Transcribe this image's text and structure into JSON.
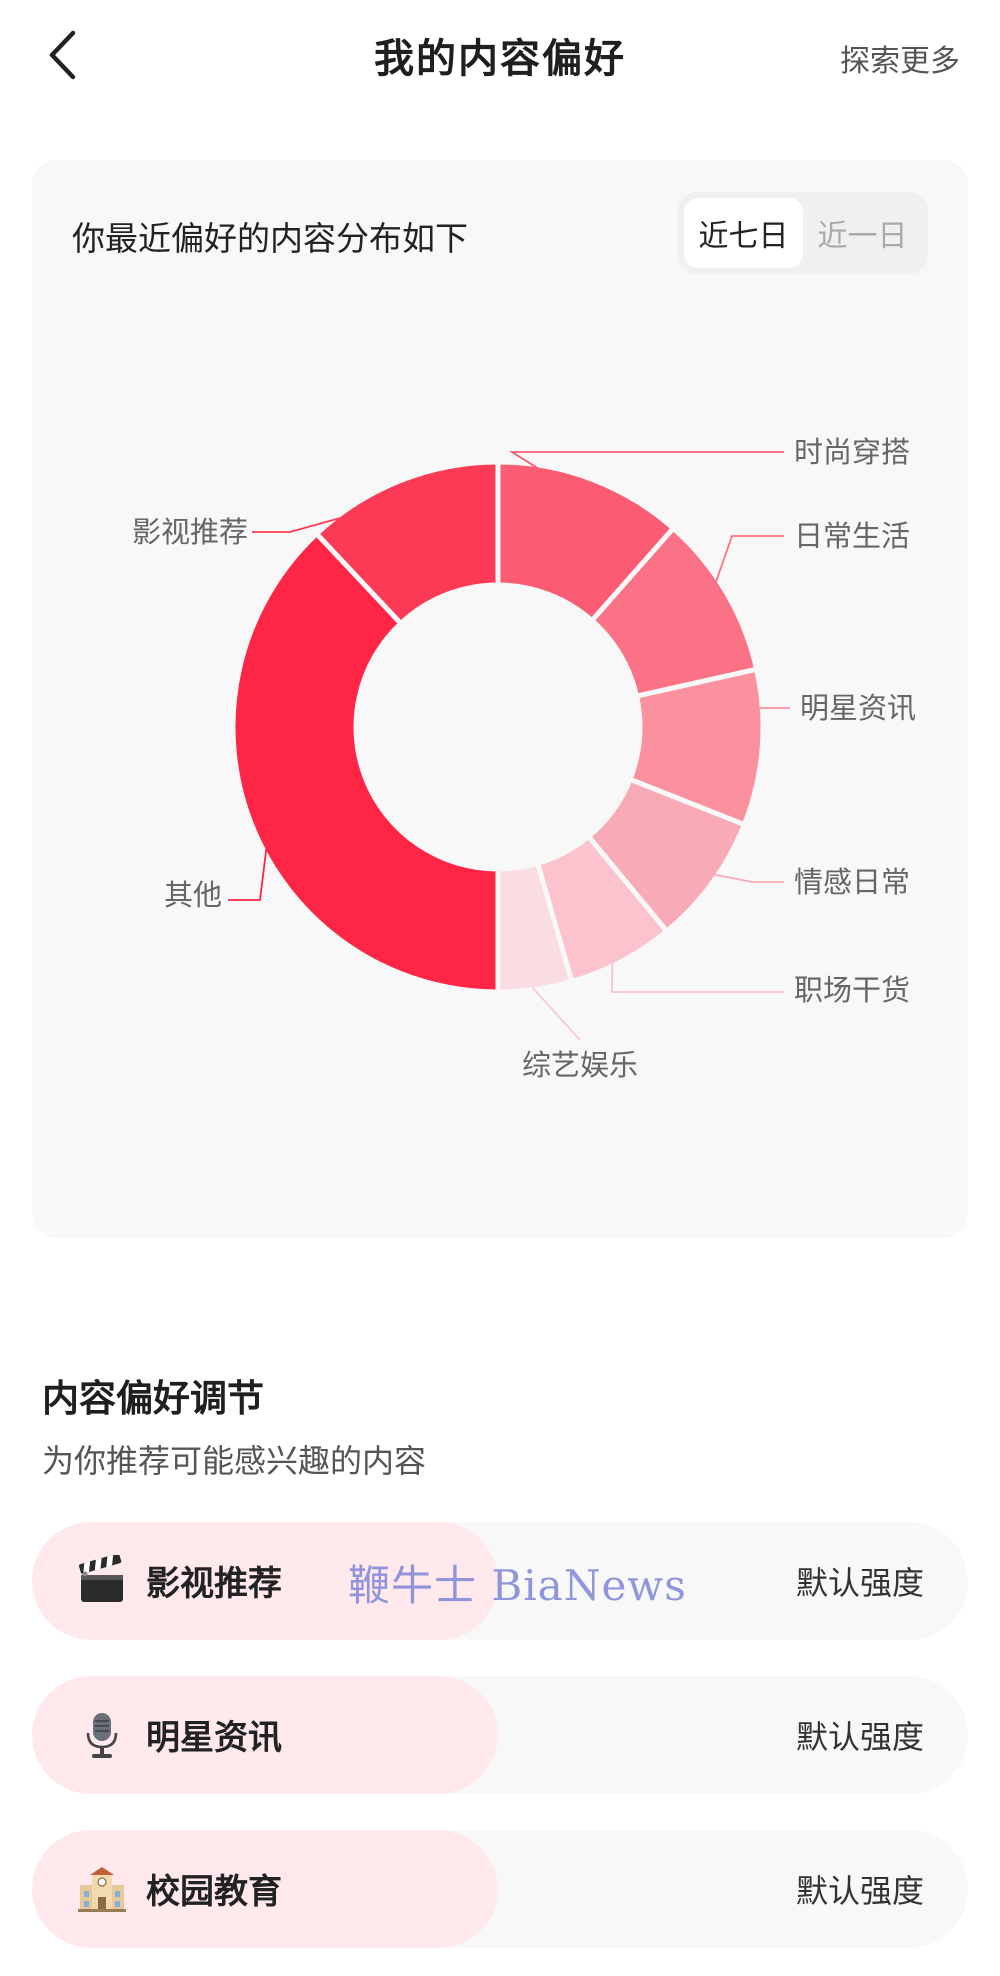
{
  "header": {
    "title": "我的内容偏好",
    "explore_more": "探索更多"
  },
  "distribution": {
    "heading": "你最近偏好的内容分布如下",
    "range_options": [
      "近七日",
      "近一日"
    ],
    "selected_range": "近七日"
  },
  "chart_data": {
    "type": "pie",
    "donut": true,
    "categories": [
      "综艺娱乐",
      "职场干货",
      "情感日常",
      "明星资讯",
      "日常生活",
      "时尚穿搭",
      "影视推荐",
      "其他"
    ],
    "values": [
      4.5,
      6.5,
      8,
      9.5,
      10,
      11.5,
      12,
      38
    ],
    "colors": [
      "#f9dde2",
      "#fac3cd",
      "#f9aab7",
      "#fb909f",
      "#fb7286",
      "#fc5c73",
      "#fd3a56",
      "#fe2545"
    ],
    "labels": {
      "综艺娱乐": "综艺娱乐",
      "职场干货": "职场干货",
      "情感日常": "情感日常",
      "明星资讯": "明星资讯",
      "日常生活": "日常生活",
      "时尚穿搭": "时尚穿搭",
      "影视推荐": "影视推荐",
      "其他": "其他"
    }
  },
  "adjust": {
    "title": "内容偏好调节",
    "subtitle": "为你推荐可能感兴趣的内容",
    "items": [
      {
        "label": "影视推荐",
        "icon": "clapperboard-icon",
        "strength": "默认强度"
      },
      {
        "label": "明星资讯",
        "icon": "microphone-icon",
        "strength": "默认强度"
      },
      {
        "label": "校园教育",
        "icon": "school-icon",
        "strength": "默认强度"
      }
    ]
  },
  "watermark": "鞭牛士 BiaNews"
}
